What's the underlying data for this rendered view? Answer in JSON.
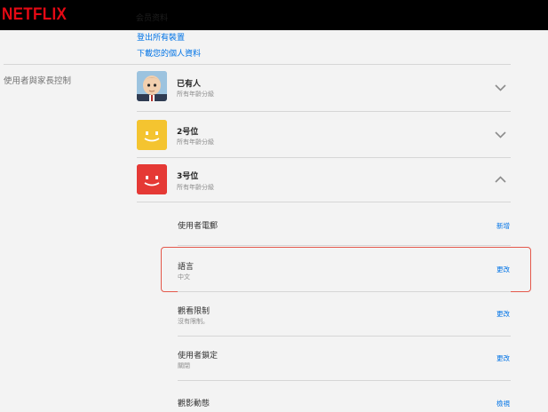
{
  "header": {
    "logo": "NETFLIX",
    "ghost_text": "会员资料"
  },
  "account": {
    "links": [
      "登出所有裝置",
      "下載您的個人資料"
    ]
  },
  "section": {
    "label": "使用者與家長控制"
  },
  "profiles": [
    {
      "name": "已有人",
      "subtitle": "所有年齡分級",
      "avatar": "baby-avatar",
      "expanded": false
    },
    {
      "name": "2号位",
      "subtitle": "所有年齡分級",
      "avatar": "yellow-smile-avatar",
      "color": "#f4c430",
      "expanded": false
    },
    {
      "name": "3号位",
      "subtitle": "所有年齡分級",
      "avatar": "red-smile-avatar",
      "color": "#e53935",
      "expanded": true
    }
  ],
  "settings": [
    {
      "title": "使用者電郵",
      "subtitle": "",
      "action": "新增"
    },
    {
      "title": "語言",
      "subtitle": "中文",
      "action": "更改"
    },
    {
      "title": "觀看限制",
      "subtitle": "沒有限制。",
      "action": "更改"
    },
    {
      "title": "使用者鎖定",
      "subtitle": "關閉",
      "action": "更改"
    },
    {
      "title": "觀影動態",
      "subtitle": "",
      "action": "檢視"
    }
  ],
  "colors": {
    "accent": "#0073e6",
    "brand": "#e50914",
    "highlight": "#e4584b"
  }
}
